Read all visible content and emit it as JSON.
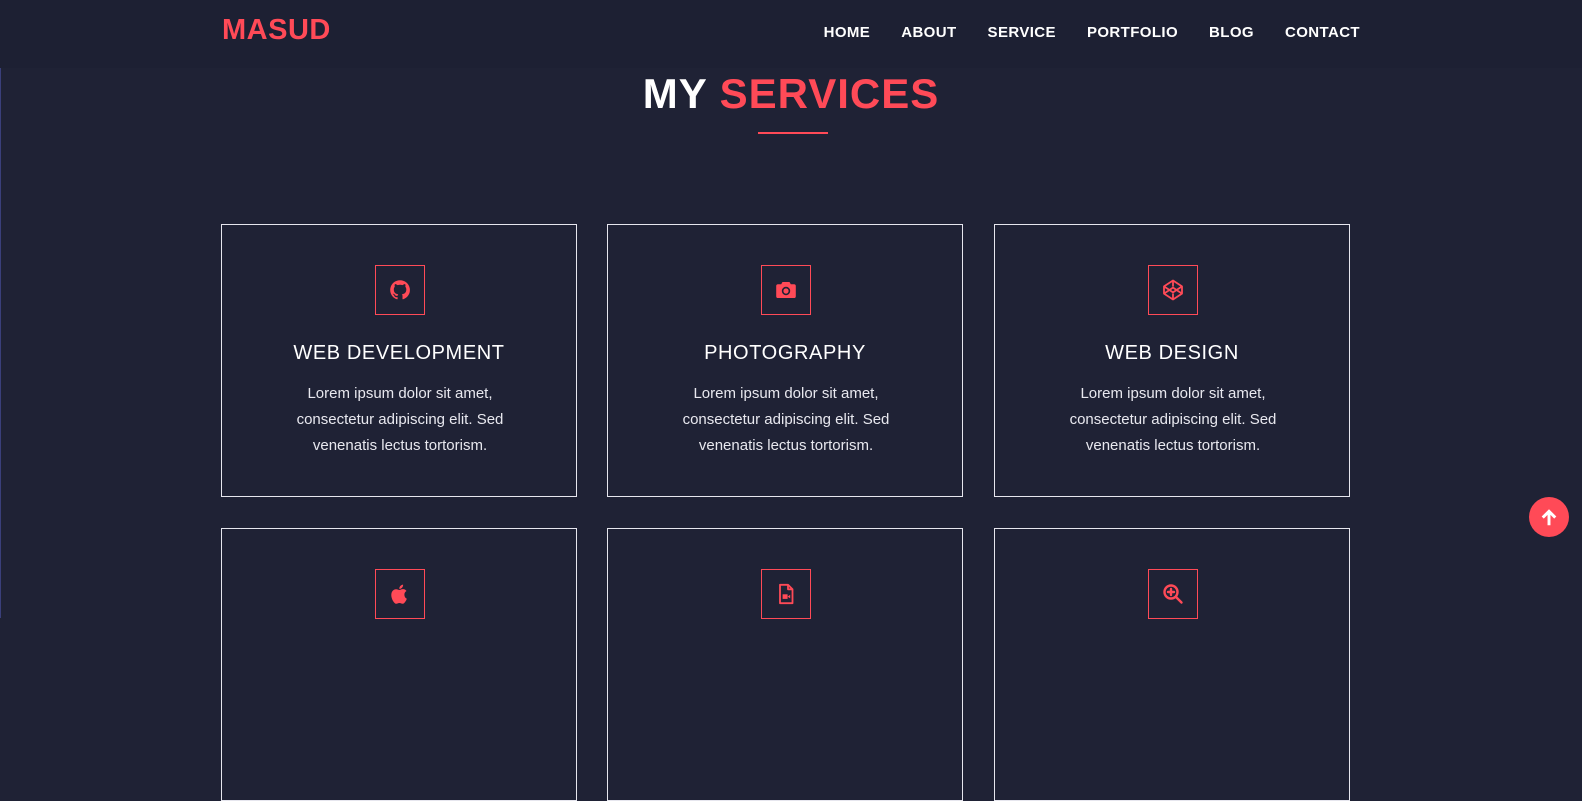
{
  "brand": {
    "logo": "MASUD",
    "accent_color": "#ff4a57",
    "background": "#1f2235"
  },
  "nav": {
    "items": [
      {
        "label": "HOME"
      },
      {
        "label": "ABOUT"
      },
      {
        "label": "SERVICE"
      },
      {
        "label": "PORTFOLIO"
      },
      {
        "label": "BLOG"
      },
      {
        "label": "CONTACT"
      }
    ]
  },
  "section": {
    "title_plain": "MY",
    "title_accent": "SERVICES"
  },
  "services": [
    {
      "icon": "github-icon",
      "title": "WEB DEVELOPMENT",
      "text": "Lorem ipsum dolor sit amet, consectetur adipiscing elit. Sed venenatis lectus tortorism."
    },
    {
      "icon": "camera-icon",
      "title": "PHOTOGRAPHY",
      "text": "Lorem ipsum dolor sit amet, consectetur adipiscing elit. Sed venenatis lectus tortorism."
    },
    {
      "icon": "codepen-icon",
      "title": "WEB DESIGN",
      "text": "Lorem ipsum dolor sit amet, consectetur adipiscing elit. Sed venenatis lectus tortorism."
    },
    {
      "icon": "apple-icon",
      "title": "",
      "text": ""
    },
    {
      "icon": "file-video-icon",
      "title": "",
      "text": ""
    },
    {
      "icon": "search-plus-icon",
      "title": "",
      "text": ""
    }
  ],
  "scroll_top": {
    "icon": "arrow-up-icon"
  }
}
